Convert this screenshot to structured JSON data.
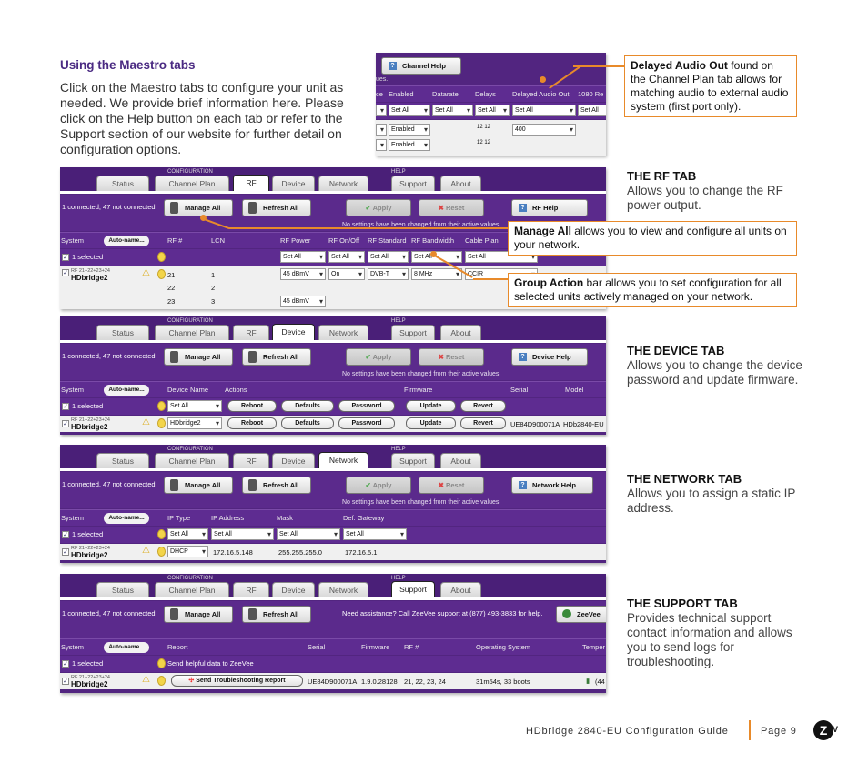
{
  "intro": {
    "title": "Using the Maestro tabs",
    "body": "Click on the Maestro tabs to configure your unit as needed. We provide brief information here. Please click on the Help button on each tab or refer to the Support section of our website for further detail on configuration options."
  },
  "callouts": {
    "delayed_audio": {
      "bold": "Delayed Audio Out",
      "text": " found on the Channel Plan tab allows for matching audio to external audio system (first port only)."
    },
    "manage_all": {
      "bold": "Manage All",
      "text": " allows you to view and configure all units on your network."
    },
    "group_action": {
      "bold": "Group Action",
      "text": " bar allows you to set configuration for all selected units actively managed on your network."
    }
  },
  "sections": {
    "rf": {
      "heading": "THE RF TAB",
      "text": "Allows you to change the RF power output."
    },
    "device": {
      "heading": "THE DEVICE TAB",
      "text": "Allows you to change the device password and update firmware."
    },
    "network": {
      "heading": "THE NETWORK TAB",
      "text": "Allows you to assign a static IP address."
    },
    "support": {
      "heading": "THE SUPPORT TAB",
      "text": "Provides technical support contact information and allows you to send logs for troubleshooting."
    }
  },
  "channel_plan_crop": {
    "help_button": "Channel Help",
    "status_fragment": "ues.",
    "columns": [
      "ce",
      "Enabled",
      "Datarate",
      "Delays",
      "Delayed Audio Out",
      "1080 Re"
    ],
    "set_all": "Set All",
    "rows": [
      {
        "enabled": "Enabled",
        "delay_value": "400"
      },
      {
        "enabled": "Enabled",
        "delay_value": ""
      }
    ],
    "delay_icon_label": "12 12"
  },
  "ui": {
    "config_label": "CONFIGURATION",
    "help_label": "HELP",
    "tabs": [
      "Status",
      "Channel Plan",
      "RF",
      "Device",
      "Network",
      "Support",
      "About"
    ],
    "connected": "1 connected, 47 not connected",
    "manage_all": "Manage All",
    "refresh_all": "Refresh All",
    "apply": "Apply",
    "reset": "Reset",
    "no_changes": "No settings have been changed from their active values.",
    "system": "System",
    "auto_name": "Auto-name...",
    "selected": "1 selected",
    "set_all": "Set All",
    "unit_sub": "RF 21+22+23+24",
    "unit_name": "HDbridge2"
  },
  "rf_panel": {
    "help_button": "RF Help",
    "columns": [
      "RF #",
      "LCN",
      "RF Power",
      "RF On/Off",
      "RF Standard",
      "RF Bandwidth",
      "Cable Plan"
    ],
    "rows": [
      {
        "rf": "21",
        "lcn": "1",
        "power": "45 dBmV",
        "onoff": "On",
        "standard": "DVB-T",
        "bandwidth": "8 MHz",
        "plan": "CCIR"
      },
      {
        "rf": "22",
        "lcn": "2"
      },
      {
        "rf": "23",
        "lcn": "3",
        "power": "45 dBmV"
      }
    ]
  },
  "device_panel": {
    "help_button": "Device Help",
    "columns": [
      "Device Name",
      "Actions",
      "Firmware",
      "Serial",
      "Model"
    ],
    "actions": [
      "Reboot",
      "Defaults",
      "Password",
      "Update",
      "Revert"
    ],
    "device_name": "HDbridge2",
    "serial": "UE84D900071A",
    "model": "HDb2840-EU"
  },
  "network_panel": {
    "help_button": "Network Help",
    "columns": [
      "IP Type",
      "IP Address",
      "Mask",
      "Def. Gateway"
    ],
    "row": {
      "ip_type": "DHCP",
      "ip": "172.16.5.148",
      "mask": "255.255.255.0",
      "gateway": "172.16.5.1"
    }
  },
  "support_panel": {
    "assist": "Need assistance? Call ZeeVee support at (877) 493-3833 for help.",
    "zeevee_button": "ZeeVee",
    "columns": [
      "Report",
      "Serial",
      "Firmware",
      "RF #",
      "Operating System",
      "Temper"
    ],
    "group_report": "Send helpful data to ZeeVee",
    "send_button": "Send Troubleshooting Report",
    "row": {
      "serial": "UE84D900071A",
      "firmware": "1.9.0.28128",
      "rf": "21, 22, 23, 24",
      "os": "31m54s, 33 boots",
      "temp": "(44"
    }
  },
  "footer": {
    "guide": "HDbridge 2840-EU Configuration Guide",
    "page": "Page 9",
    "logo": "Z",
    "logo_v": "V"
  }
}
